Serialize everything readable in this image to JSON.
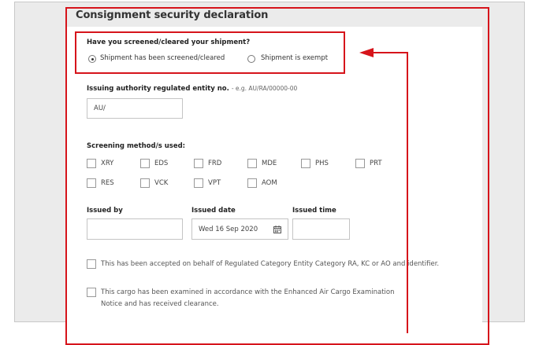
{
  "form": {
    "title": "Consignment security declaration",
    "question": "Have you screened/cleared your shipment?",
    "options": [
      {
        "label": "Shipment has been screened/cleared",
        "selected": true
      },
      {
        "label": "Shipment is exempt",
        "selected": false
      }
    ],
    "issuing_authority": {
      "label": "Issuing authority regulated entity no.",
      "hint": "- e.g. AU/RA/00000-00",
      "value": "AU/"
    },
    "screening": {
      "label": "Screening method/s used:",
      "methods": [
        "XRY",
        "EDS",
        "FRD",
        "MDE",
        "PHS",
        "PRT",
        "RES",
        "VCK",
        "VPT",
        "AOM"
      ]
    },
    "issued_by": {
      "label": "Issued by",
      "value": ""
    },
    "issued_date": {
      "label": "Issued date",
      "value": "Wed 16 Sep 2020"
    },
    "issued_time": {
      "label": "Issued time",
      "value": ""
    },
    "declarations": [
      "This has been accepted on behalf of Regulated Category Entity Category RA, KC or AO and identifier.",
      "This cargo has been examined in accordance with the Enhanced Air Cargo Examination Notice and has received clearance."
    ]
  },
  "annotation": {
    "color": "#d6141b"
  }
}
